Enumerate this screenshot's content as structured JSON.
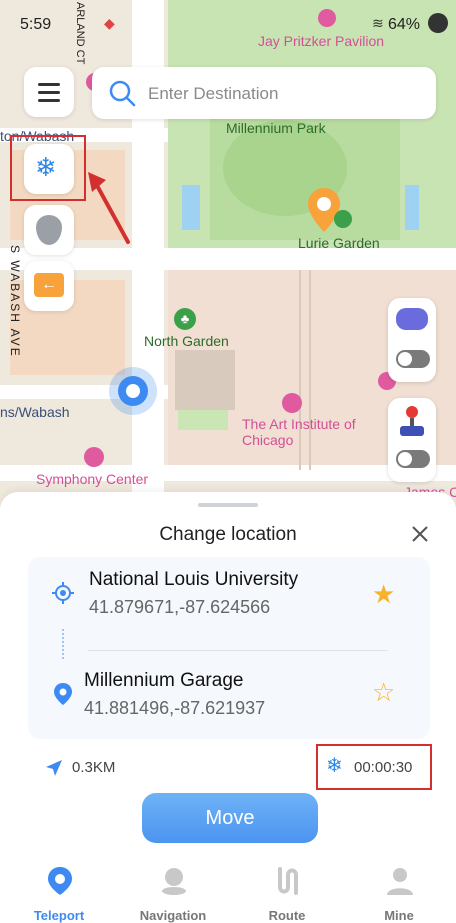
{
  "status": {
    "time": "5:59",
    "battery": "64%"
  },
  "map": {
    "labels": {
      "street_top": "ARLAND CT",
      "pavilion": "Jay Pritzker Pavilion",
      "park": "Millennium Park",
      "lurie": "Lurie Garden",
      "north_garden": "North Garden",
      "wabash1": "ton/Wabash",
      "wabash2": "ns/Wabash",
      "wabash_ave": "S WABASH AVE",
      "art_institute": "The Art Institute of Chicago",
      "symphony": "Symphony Center",
      "james": "James C"
    }
  },
  "search": {
    "placeholder": "Enter Destination"
  },
  "sheet": {
    "title": "Change location",
    "origin": {
      "name": "National Louis University",
      "coords": "41.879671,-87.624566"
    },
    "destination": {
      "name": "Millennium Garage",
      "coords": "41.881496,-87.621937"
    },
    "distance": "0.3KM",
    "timer": "00:00:30",
    "move_label": "Move"
  },
  "tabs": [
    {
      "label": "Teleport",
      "active": true
    },
    {
      "label": "Navigation",
      "active": false
    },
    {
      "label": "Route",
      "active": false
    },
    {
      "label": "Mine",
      "active": false
    }
  ],
  "colors": {
    "accent": "#3d8bf2",
    "park": "#c9e6b4",
    "highlight": "#d32f2f",
    "poi": "#e05aa0"
  }
}
